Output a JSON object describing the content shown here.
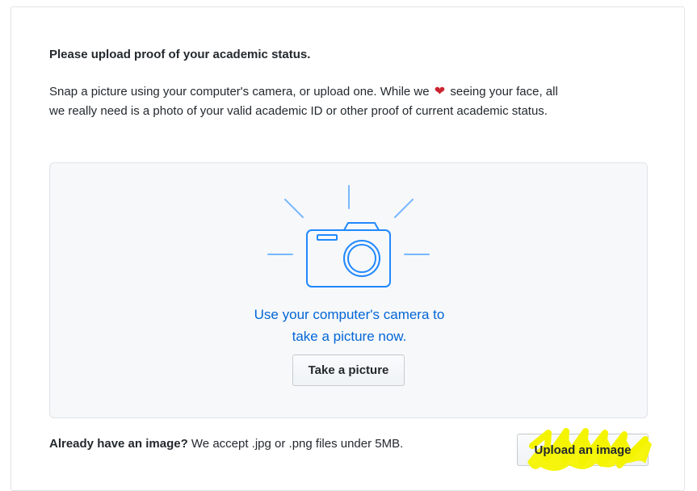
{
  "form": {
    "heading": "Please upload proof of your academic status.",
    "intro_before_heart": "Snap a picture using your computer's camera, or upload one. While we",
    "heart_icon": "heart-icon",
    "intro_after_heart": "seeing your face, all we really need is a photo of your valid academic ID or other proof of current academic status."
  },
  "camera_panel": {
    "icon": "camera-icon",
    "caption_line1": "Use your computer's camera to",
    "caption_line2": "take a picture now.",
    "take_picture_label": "Take a picture"
  },
  "footer": {
    "question": "Already have an image?",
    "accept_text": "We accept .jpg or .png files under 5MB.",
    "upload_label": "Upload an image"
  },
  "colors": {
    "accent_blue": "#0366d6",
    "icon_blue": "#2188ff",
    "heart_red": "#cb2431",
    "highlight_yellow": "#f4f400"
  }
}
